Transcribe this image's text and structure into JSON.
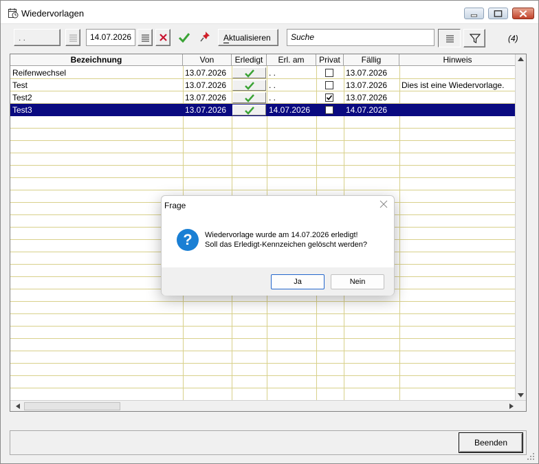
{
  "window": {
    "title": "Wiedervorlagen"
  },
  "toolbar": {
    "from_date": ". .",
    "to_date": "14.07.2026",
    "refresh_label": "Aktualisieren",
    "search_placeholder": "Suche",
    "count": "(4)"
  },
  "columns": [
    "Bezeichnung",
    "Von",
    "Erledigt",
    "Erl. am",
    "Privat",
    "Fällig",
    "Hinweis"
  ],
  "rows": [
    {
      "bezeichnung": "Reifenwechsel",
      "von": "13.07.2026",
      "erledigt": true,
      "erl_am": ". .",
      "privat": false,
      "faellig": "13.07.2026",
      "hinweis": ""
    },
    {
      "bezeichnung": "Test",
      "von": "13.07.2026",
      "erledigt": true,
      "erl_am": ". .",
      "privat": false,
      "faellig": "13.07.2026",
      "hinweis": "Dies ist eine Wiedervorlage."
    },
    {
      "bezeichnung": "Test2",
      "von": "13.07.2026",
      "erledigt": true,
      "erl_am": ". .",
      "privat": true,
      "faellig": "13.07.2026",
      "hinweis": ""
    },
    {
      "bezeichnung": "Test3",
      "von": "13.07.2026",
      "erledigt": true,
      "erl_am": "14.07.2026",
      "privat": false,
      "faellig": "14.07.2026",
      "hinweis": "",
      "selected": true
    }
  ],
  "footer": {
    "close_label": "Beenden"
  },
  "dialog": {
    "title": "Frage",
    "line1": "Wiedervorlage wurde am 14.07.2026 erledigt!",
    "line2": "Soll das Erledigt-Kennzeichen gelöscht werden?",
    "yes_label": "Ja",
    "no_label": "Nein"
  },
  "colors": {
    "selection": "#0a0a80",
    "grid_lines": "#d8d08a",
    "check": "#3aa335",
    "delete": "#c8102e"
  }
}
